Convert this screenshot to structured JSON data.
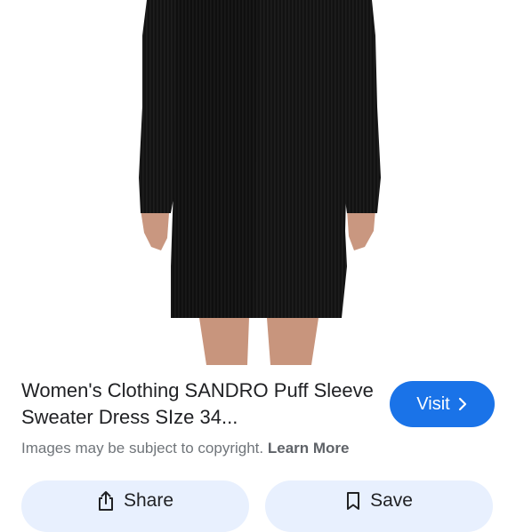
{
  "result": {
    "title": "Women's Clothing SANDRO Puff Sleeve Sweater Dress SIze 34...",
    "visit_label": "Visit",
    "copyright_text": "Images may be subject to copyright.",
    "learn_more_label": "Learn More"
  },
  "actions": {
    "share_label": "Share",
    "save_label": "Save"
  },
  "icons": {
    "visit": "chevron-right-icon",
    "share": "share-icon",
    "save": "bookmark-icon"
  },
  "colors": {
    "accent": "#1a73e8",
    "action_bg": "#e8f0fe",
    "title_text": "#202124",
    "muted_text": "#70757a"
  }
}
